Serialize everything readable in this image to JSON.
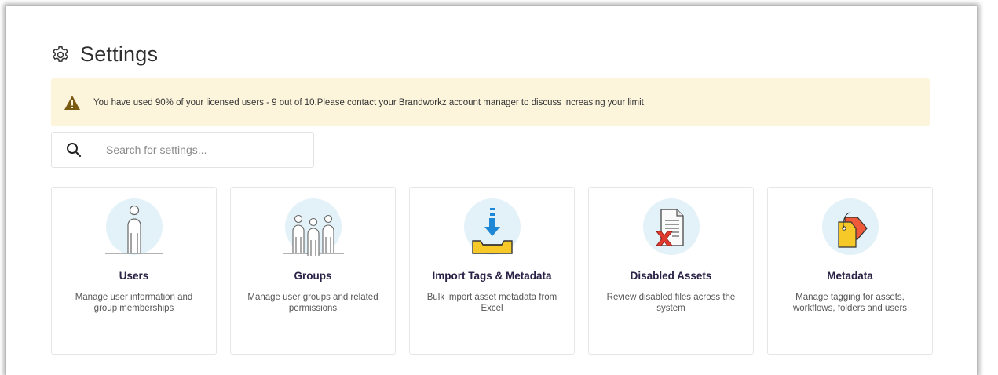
{
  "header": {
    "title": "Settings",
    "icon": "gear-icon"
  },
  "alert": {
    "icon": "warning-icon",
    "color": "#fcf5dc",
    "message": "You have used 90% of your licensed users - 9 out of 10.Please contact your Brandworkz account manager to discuss increasing your limit."
  },
  "search": {
    "placeholder": "Search for settings...",
    "value": "",
    "icon": "search-icon"
  },
  "cards": [
    {
      "title": "Users",
      "description": "Manage user information and group memberships",
      "icon": "user-icon"
    },
    {
      "title": "Groups",
      "description": "Manage user groups and related permissions",
      "icon": "group-icon"
    },
    {
      "title": "Import Tags & Metadata",
      "description": "Bulk import asset metadata from Excel",
      "icon": "import-tray-icon"
    },
    {
      "title": "Disabled Assets",
      "description": "Review disabled files across the system",
      "icon": "disabled-document-icon"
    },
    {
      "title": "Metadata",
      "description": "Manage tagging for assets, workflows, folders and users",
      "icon": "tags-icon"
    }
  ],
  "colors": {
    "title_text": "#2b2347",
    "circle": "#e3f2f8"
  }
}
